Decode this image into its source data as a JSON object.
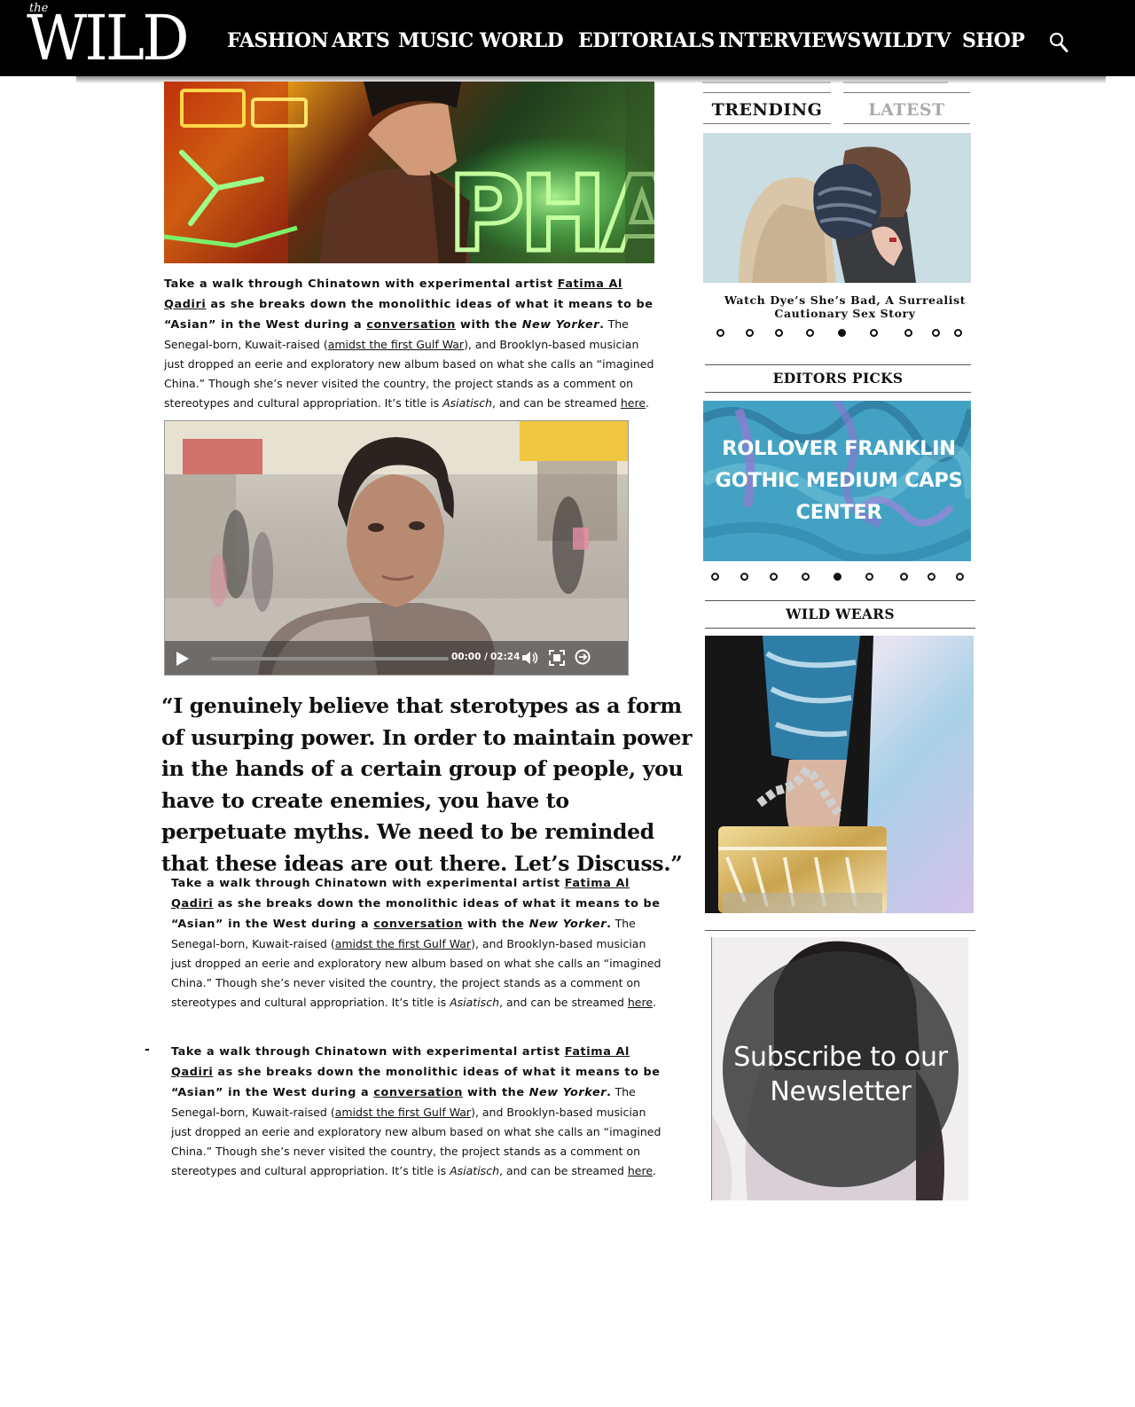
{
  "header": {
    "logo_small": "the",
    "logo": "WILD",
    "nav": [
      "FASHION",
      "ARTS",
      "MUSIC",
      "WORLD",
      "EDITORIALS",
      "INTERVIEWS",
      "WILDTV",
      "SHOP"
    ]
  },
  "article": {
    "hero_sign_text": "PHARM",
    "paragraph": {
      "lead_1": "Take a walk through Chinatown with experimental artist ",
      "artist_link": "Fatima Al Qadiri",
      "lead_2": " as she breaks down the monolithic ideas of what it means to be “Asian” in the West during a ",
      "conversation_link": "conversation",
      "lead_3": " with the ",
      "publication": "New Yorker",
      "lead_4": ".",
      "body_1": " The Senegal-born, Kuwait-raised (",
      "gulf_link": "amidst the first Gulf War",
      "body_2": "), and Brooklyn-based musician just dropped an eerie and exploratory new album based on what she calls an “imagined China.” Though she’s never visited the country, the project stands as a comment on stereotypes and cultural appropriation. It’s title is ",
      "album": "Asiatisch",
      "body_3": ", and can be streamed ",
      "here_link": "here",
      "body_4": "."
    },
    "video": {
      "current_time": "00:00 /",
      "duration": "02:24"
    },
    "quote": "“I genuinely believe that sterotypes as a form of usurping power. In order to maintain power in the hands of a certain group of people, you have to create enemies, you have to perpetuate myths. We need to be reminded that these ideas are out there. Let’s  Discuss.”",
    "bullet_marker": "-"
  },
  "sidebar": {
    "tabs": [
      "TRENDING",
      "LATEST"
    ],
    "trending_caption": "Watch Dye’s She’s Bad, A Surrealist Cautionary Sex Story",
    "trending_active_dot": 5,
    "editors_heading": "EDITORS PICKS",
    "editors_promo_text": "ROLLOVER FRANKLIN GOTHIC MEDIUM CAPS CENTER",
    "editors_active_dot": 5,
    "wild_wears_heading": "WILD WEARS",
    "newsletter_line1": "Subscribe to our",
    "newsletter_line2": "Newsletter",
    "colors": {
      "promo_bg": "#3fa4c4",
      "circle": "#323232"
    }
  }
}
